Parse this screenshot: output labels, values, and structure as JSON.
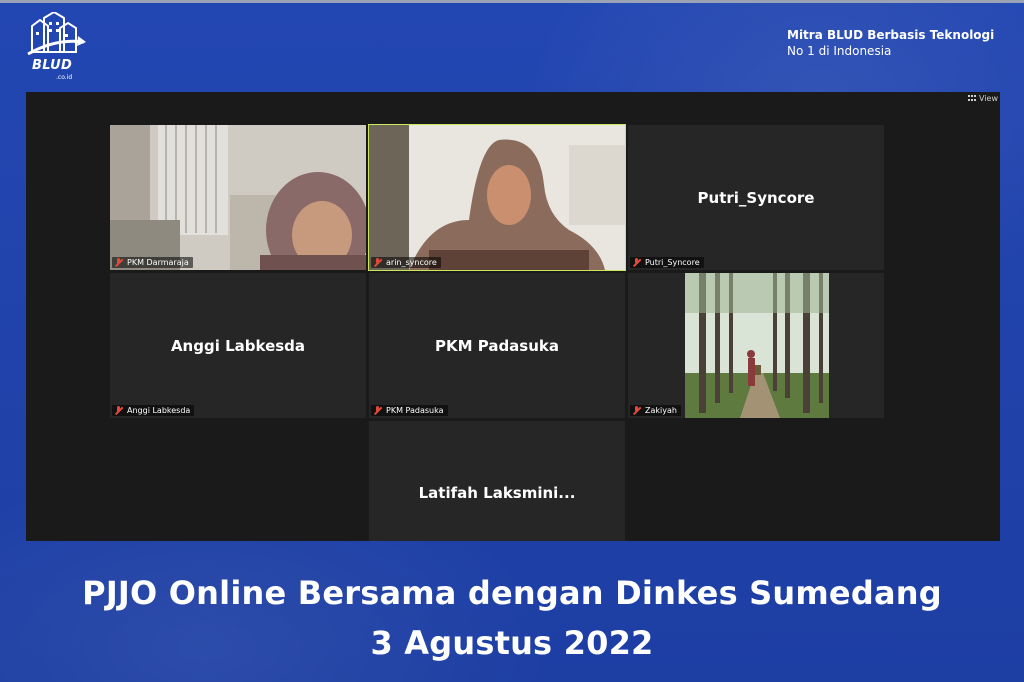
{
  "brand": {
    "logo_text": "BLUD",
    "logo_subtext": ".co.id",
    "tagline_line1": "Mitra BLUD Berbasis Teknologi",
    "tagline_line2": "No 1 di Indonesia"
  },
  "meeting": {
    "view_label": "View",
    "participants": [
      {
        "display_name": "",
        "label": "PKM Darmaraja",
        "video": true,
        "muted": true,
        "active": false
      },
      {
        "display_name": "",
        "label": "arin_syncore",
        "video": true,
        "muted": true,
        "active": true
      },
      {
        "display_name": "Putri_Syncore",
        "label": "Putri_Syncore",
        "video": false,
        "muted": true,
        "active": false
      },
      {
        "display_name": "Anggi Labkesda",
        "label": "Anggi Labkesda",
        "video": false,
        "muted": true,
        "active": false
      },
      {
        "display_name": "PKM Padasuka",
        "label": "PKM Padasuka",
        "video": false,
        "muted": true,
        "active": false
      },
      {
        "display_name": "",
        "label": "Zakiyah",
        "video": true,
        "muted": true,
        "active": false
      },
      {
        "display_name": "Latifah  Laksmini...",
        "label": "",
        "video": false,
        "muted": false,
        "active": false
      }
    ]
  },
  "caption": {
    "line1": "PJJO Online Bersama dengan Dinkes Sumedang",
    "line2": "3 Agustus 2022"
  },
  "colors": {
    "background": "#1f3fa8",
    "meeting_bg": "#1a1a1a",
    "tile_bg": "#262626",
    "active_speaker": "#c9e65d",
    "muted_icon": "#e04a3a"
  }
}
